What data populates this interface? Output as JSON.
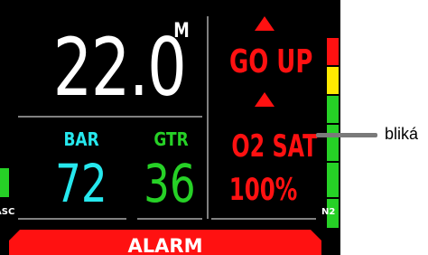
{
  "depth": {
    "value": "22.0",
    "unit": "M"
  },
  "tanks": {
    "bar": {
      "label": "BAR",
      "value": "72"
    },
    "gtr": {
      "label": "GTR",
      "value": "36"
    }
  },
  "alerts": {
    "go_up": "GO UP",
    "o2_sat_label": "O2 SAT",
    "o2_sat_value": "100%"
  },
  "n2_bar": {
    "label": "N2",
    "segments": [
      "#ff1111",
      "#ffea00",
      "#26d126",
      "#26d126",
      "#26d126",
      "#26d126"
    ]
  },
  "ascent": {
    "label": "ASC"
  },
  "alarm": {
    "label": "ALARM"
  },
  "callout": {
    "text": "bliká"
  },
  "colors": {
    "cyan": "#26e8ee",
    "green": "#26d126",
    "red": "#ff1111",
    "yellow": "#ffea00"
  }
}
